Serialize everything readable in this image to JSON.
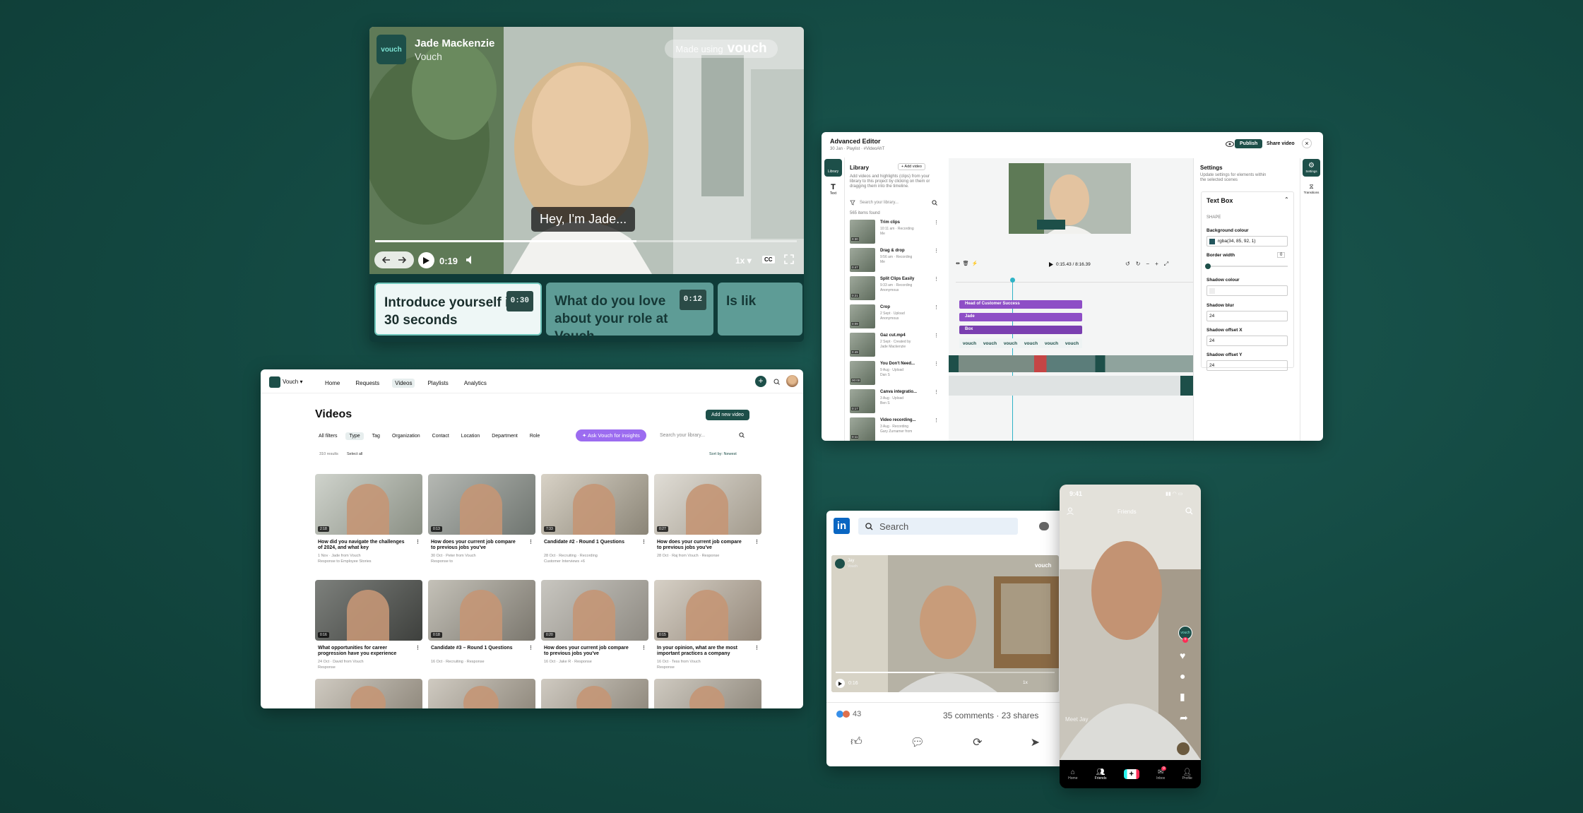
{
  "colors": {
    "background": "#134841",
    "brand": "#1d4f49",
    "accent": "#7de3d4",
    "purple": "#8e4ec6",
    "linkedin": "#0a66c2"
  },
  "player": {
    "logo": "vouch",
    "name": "Jade Mackenzie",
    "company": "Vouch",
    "watermark_prefix": "Made using",
    "watermark_brand": "vouch",
    "caption": "Hey, I'm Jade...",
    "time": "0:19",
    "speed": "1x",
    "cc": "CC",
    "progress": 0.62,
    "questions": [
      {
        "text": "Introduce yourself in 30 seconds",
        "duration": "0:30"
      },
      {
        "text": "What do you love about your role at Vouch",
        "duration": "0:12"
      },
      {
        "text": "Is lik",
        "duration": ""
      }
    ]
  },
  "editor": {
    "title": "Advanced Editor",
    "subtitle": "30 Jan · Playlist · #VideoAhT",
    "publish": "Publish",
    "share": "Share video",
    "left_tabs": [
      "Library",
      "Text"
    ],
    "library": {
      "heading": "Library",
      "add_video": "+ Add video",
      "desc": "Add videos and highlights (clips) from your library to this project by clicking on them or dragging them into the timeline.",
      "search_placeholder": "Search your library...",
      "count": "565 items found",
      "items": [
        {
          "title": "Trim clips",
          "meta": "10:11 am · Recording",
          "sub": "Me",
          "dur": "0:30"
        },
        {
          "title": "Drag & drop",
          "meta": "9:56 am · Recording",
          "sub": "Me",
          "dur": "0:47"
        },
        {
          "title": "Split Clips Easily",
          "meta": "9:33 am · Recording",
          "sub": "Anonymous",
          "dur": "0:21"
        },
        {
          "title": "Crop",
          "meta": "2 Sept · Upload",
          "sub": "Anonymous",
          "dur": "0:09"
        },
        {
          "title": "Gaz cut.mp4",
          "meta": "2 Sept · Created by",
          "sub": "Jade Mackenzie",
          "dur": "0:49"
        },
        {
          "title": "You Don't Need...",
          "meta": "9 Aug · Upload",
          "sub": "Dan S",
          "dur": "00:00"
        },
        {
          "title": "Canva integratio...",
          "meta": "3 Aug · Upload",
          "sub": "Ben S",
          "dur": "0:17"
        },
        {
          "title": "Video recording...",
          "meta": "3 Aug · Recording",
          "sub": "Gary Zurnamer from",
          "dur": "0:11"
        }
      ]
    },
    "time": "0:15.43 / 8:16.39",
    "tracks": [
      "Head of Customer Success",
      "Jade",
      "Box"
    ],
    "vouch_label": "vouch",
    "settings": {
      "heading": "Settings",
      "desc": "Update settings for elements within the selected scenes",
      "section": "Text Box",
      "shape": "SHAPE",
      "bg_label": "Background colour",
      "bg_value": "rgba(34, 85, 92, 1)",
      "border_label": "Border width",
      "border_value": "0",
      "shadow_colour_label": "Shadow colour",
      "blur_label": "Shadow blur",
      "blur_value": "24",
      "offx_label": "Shadow offset X",
      "offx_value": "24",
      "offy_label": "Shadow offset Y",
      "offy_value": "24"
    },
    "right_tabs": [
      "Settings",
      "Transitions"
    ]
  },
  "videos": {
    "workspace": "Vouch",
    "nav": [
      "Home",
      "Requests",
      "Videos",
      "Playlists",
      "Analytics"
    ],
    "nav_active": "Videos",
    "title": "Videos",
    "add_button": "Add new video",
    "filters": [
      "All filters",
      "Type",
      "Tag",
      "Organization",
      "Contact",
      "Location",
      "Department",
      "Role"
    ],
    "ask": "Ask Vouch for insights",
    "search_placeholder": "Search your library...",
    "results": "310 results",
    "select_all": "Select all",
    "sort": "Sort by: Newest",
    "cards": [
      {
        "title": "How did you navigate the challenges of 2024, and what key",
        "meta": "1 Nov · Jade from Vouch",
        "sub": "Response to Employee Stories",
        "dur": "2:18"
      },
      {
        "title": "How does your current job compare to previous jobs you've",
        "meta": "30 Oct · Peter from Vouch",
        "sub": "Response to",
        "dur": "0:13"
      },
      {
        "title": "Candidate #2 - Round 1 Questions",
        "meta": "28 Oct · Recruiting · Recording",
        "sub": "Customer Interviews  +6",
        "dur": "7:33"
      },
      {
        "title": "How does your current job compare to previous jobs you've",
        "meta": "28 Oct · Raj from Vouch · Response",
        "sub": "",
        "dur": "0:27"
      },
      {
        "title": "What opportunities for career progression have you experience",
        "meta": "24 Oct · David from Vouch",
        "sub": "Response",
        "dur": "0:16"
      },
      {
        "title": "Candidate #3 – Round 1 Questions",
        "meta": "16 Oct · Recruiting · Response",
        "sub": "",
        "dur": "0:18"
      },
      {
        "title": "How does your current job compare to previous jobs you've",
        "meta": "16 Oct · Jake R · Response",
        "sub": "",
        "dur": "0:20"
      },
      {
        "title": "In your opinion, what are the most important practices a company",
        "meta": "16 Oct · Tess from Vouch",
        "sub": "Response",
        "dur": "0:15"
      }
    ]
  },
  "linkedin": {
    "logo": "in",
    "search": "Search",
    "overlay_name": "Jay",
    "overlay_company": "Vouch",
    "watermark": "vouch",
    "time": "0:16",
    "speed": "1x",
    "reactions": "43",
    "comments": "35 comments",
    "shares": "23 shares",
    "progress": 0.45
  },
  "tiktok": {
    "time": "9:41",
    "tab": "Friends",
    "badge": "vouch",
    "nav": [
      "Home",
      "Friends",
      "",
      "Inbox",
      "Profile"
    ],
    "inbox_count": "9",
    "caption": "Meet Jay"
  }
}
